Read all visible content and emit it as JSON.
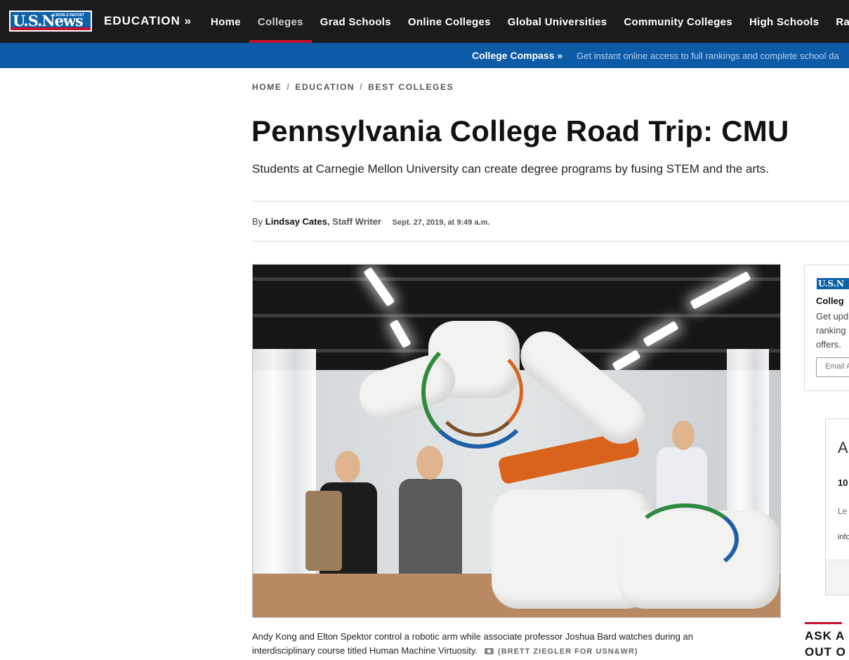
{
  "brand": {
    "logo_text": "U.S.News",
    "logo_subtext": "& WORLD REPORT",
    "section": "EDUCATION »"
  },
  "nav": {
    "items": [
      {
        "label": "Home"
      },
      {
        "label": "Colleges"
      },
      {
        "label": "Grad Schools"
      },
      {
        "label": "Online Colleges"
      },
      {
        "label": "Global Universities"
      },
      {
        "label": "Community Colleges"
      },
      {
        "label": "High Schools"
      },
      {
        "label": "Rankin"
      }
    ],
    "active": "Colleges"
  },
  "compass": {
    "title": "College Compass »",
    "text": "Get instant online access to full rankings and complete school da"
  },
  "breadcrumb": {
    "items": [
      "HOME",
      "EDUCATION",
      "BEST COLLEGES"
    ],
    "separator": "/"
  },
  "article": {
    "headline": "Pennsylvania College Road Trip: CMU",
    "dek": "Students at Carnegie Mellon University can create degree programs by fusing STEM and the arts.",
    "byline_prefix": "By",
    "author": "Lindsay Cates",
    "role": ", Staff Writer",
    "date": "Sept. 27, 2019, at 9:49 a.m."
  },
  "photo": {
    "caption": "Andy Kong and Elton Spektor control a robotic arm while associate professor Joshua Bard watches during an interdisciplinary course titled Human Machine Virtuosity.",
    "credit": "(BRETT ZIEGLER FOR USN&WR)",
    "camera_icon": "camera-icon"
  },
  "sidebar": {
    "card1": {
      "logo": "U.S.N",
      "title": "Colleg",
      "text": "Get upd ranking offers.",
      "email_placeholder": "Email A"
    },
    "card2": {
      "big": "A",
      "num": "10",
      "t1": "Le Lib",
      "t3": "info"
    },
    "ask": {
      "line1": "ASK A",
      "line2": "OUT O"
    }
  },
  "colors": {
    "nav_bg": "#1b1b1b",
    "compass_bg": "#0d5aa7",
    "accent_red": "#c8102e",
    "logo_blue": "#0d61a9"
  }
}
